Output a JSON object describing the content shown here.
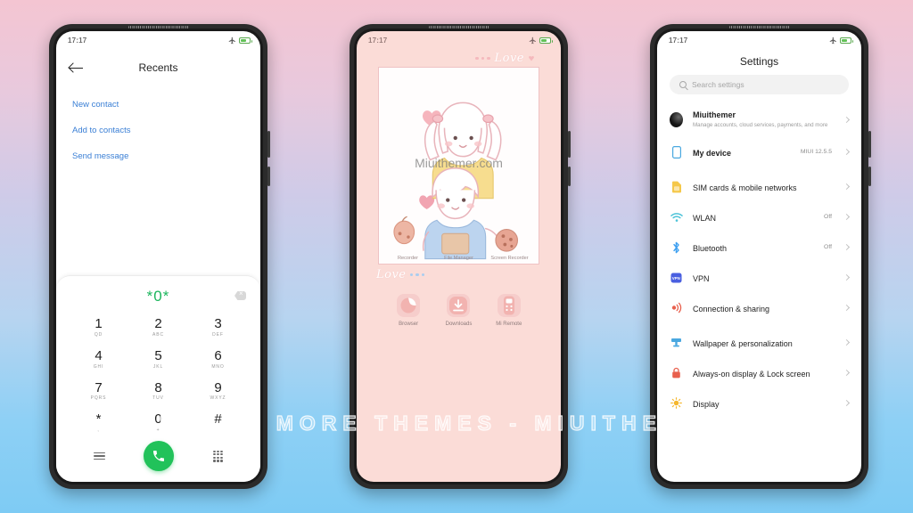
{
  "watermark": "VISIT FOR MORE THEMES - MIUITHEMER.COM",
  "status_bar": {
    "time": "17:17",
    "airplane_icon": "airplane-icon",
    "battery_icon": "battery-icon"
  },
  "phone1": {
    "app": "Recents",
    "back_icon": "back-arrow-icon",
    "title": "Recents",
    "links": [
      {
        "label": "New contact"
      },
      {
        "label": "Add to contacts"
      },
      {
        "label": "Send message"
      }
    ],
    "dialer": {
      "entered_number": "*0*",
      "backspace_icon": "backspace-icon",
      "keys": [
        {
          "digit": "1",
          "letters": "QD"
        },
        {
          "digit": "2",
          "letters": "ABC"
        },
        {
          "digit": "3",
          "letters": "DEF"
        },
        {
          "digit": "4",
          "letters": "GHI"
        },
        {
          "digit": "5",
          "letters": "JKL"
        },
        {
          "digit": "6",
          "letters": "MNO"
        },
        {
          "digit": "7",
          "letters": "PQRS"
        },
        {
          "digit": "8",
          "letters": "TUV"
        },
        {
          "digit": "9",
          "letters": "WXYZ"
        },
        {
          "digit": "*",
          "letters": ","
        },
        {
          "digit": "0",
          "letters": "+"
        },
        {
          "digit": "#",
          "letters": ""
        }
      ],
      "menu_icon": "menu-lines-icon",
      "call_icon": "call-icon",
      "keypad_icon": "keypad-grid-icon"
    },
    "accent_green": "#21c25a",
    "link_blue": "#3a7fd5"
  },
  "phone2": {
    "wallpaper_watermark": "Miuithemer.com",
    "deco_top_text": "Love",
    "deco_bottom_text": "Love",
    "widget_labels": [
      "Recorder",
      "File Manager",
      "Screen Recorder"
    ],
    "apps": [
      {
        "label": "Browser",
        "icon": "browser-icon"
      },
      {
        "label": "Downloads",
        "icon": "download-icon"
      },
      {
        "label": "Mi Remote",
        "icon": "remote-icon"
      }
    ],
    "bg_color": "#fbdcd7"
  },
  "phone3": {
    "title": "Settings",
    "search": {
      "placeholder": "Search settings",
      "icon": "search-icon"
    },
    "account": {
      "name": "Miuithemer",
      "subtitle": "Manage accounts, cloud services, payments, and more",
      "avatar": "avatar-icon"
    },
    "device": {
      "label": "My device",
      "value": "MIUI 12.5.5",
      "icon": "device-icon"
    },
    "items": [
      {
        "label": "SIM cards & mobile networks",
        "value": "",
        "icon": "sim-card-icon"
      },
      {
        "label": "WLAN",
        "value": "Off",
        "icon": "wifi-icon"
      },
      {
        "label": "Bluetooth",
        "value": "Off",
        "icon": "bluetooth-icon"
      },
      {
        "label": "VPN",
        "value": "",
        "icon": "vpn-icon"
      },
      {
        "label": "Connection & sharing",
        "value": "",
        "icon": "connection-sharing-icon"
      }
    ],
    "items2": [
      {
        "label": "Wallpaper & personalization",
        "value": "",
        "icon": "wallpaper-icon"
      },
      {
        "label": "Always-on display & Lock screen",
        "value": "",
        "icon": "lock-icon"
      },
      {
        "label": "Display",
        "value": "",
        "icon": "display-brightness-icon"
      }
    ]
  }
}
